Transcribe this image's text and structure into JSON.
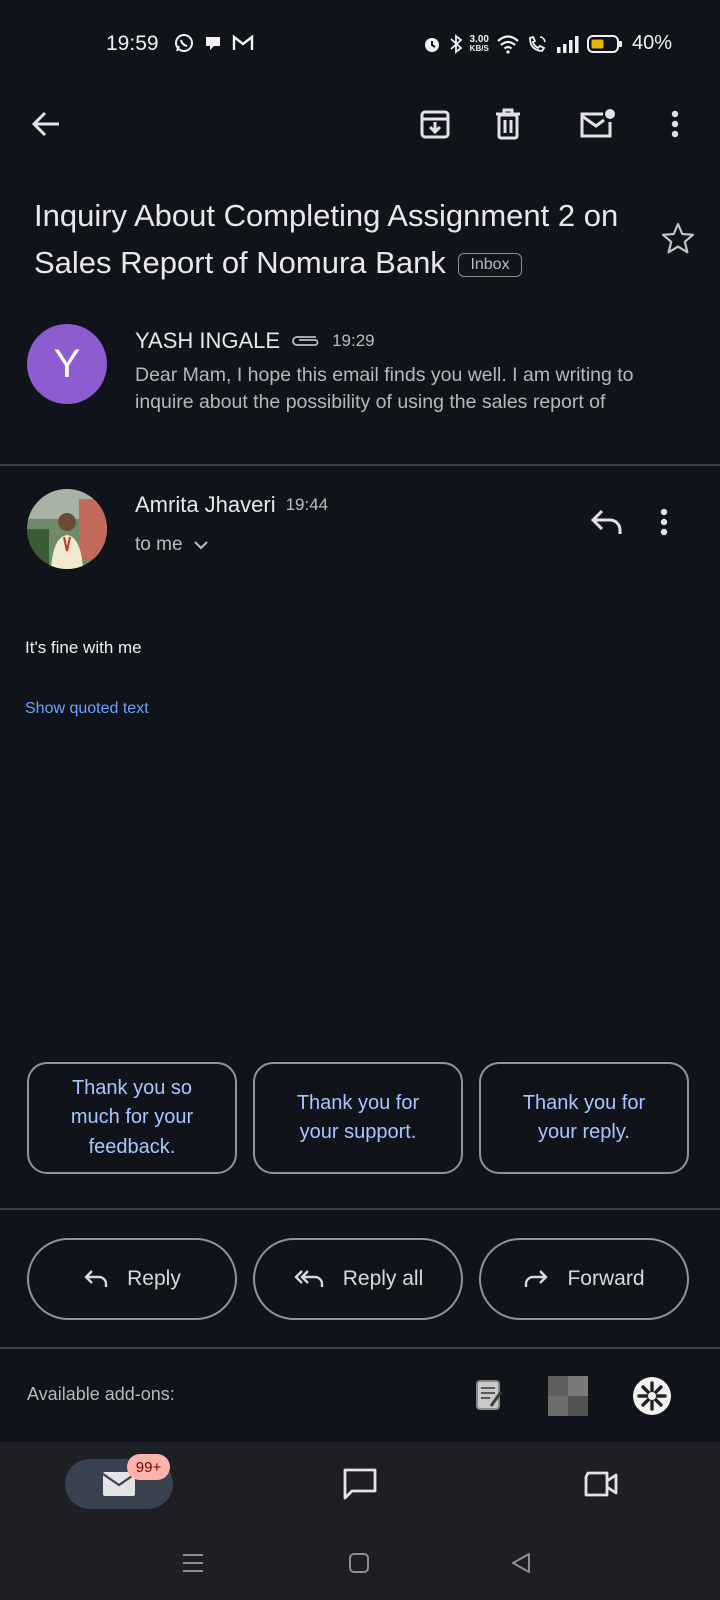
{
  "status_bar": {
    "time": "19:59",
    "net_speed_value": "3.00",
    "net_speed_unit": "KB/S",
    "battery": "40%"
  },
  "topbar": {
    "icons": [
      "back-arrow-icon",
      "archive-icon",
      "delete-icon",
      "mark-unread-icon",
      "more-vert-icon"
    ]
  },
  "thread": {
    "subject": "Inquiry About Completing Assignment 2 on Sales Report of Nomura Bank",
    "label": "Inbox"
  },
  "message1": {
    "avatar_letter": "Y",
    "avatar_color": "#8f5bd1",
    "sender": "YASH INGALE",
    "time": "19:29",
    "snippet": "Dear Mam, I hope this email finds you well. I am writing to inquire about the possibility of using the sales report of"
  },
  "message2": {
    "sender": "Amrita Jhaveri",
    "time": "19:44",
    "recipient": "to me",
    "body": "It's fine with me",
    "show_quoted": "Show quoted text"
  },
  "smart_replies": [
    "Thank you so much for your feedback.",
    "Thank you for your support.",
    "Thank you for your reply."
  ],
  "actions": {
    "reply": "Reply",
    "reply_all": "Reply all",
    "forward": "Forward"
  },
  "addons": {
    "label": "Available add-ons:"
  },
  "bottom_nav": {
    "mail_badge": "99+"
  },
  "colors": {
    "background": "#11131a",
    "accent_link": "#6da3ff",
    "smart_reply_text": "#a9c7ff"
  }
}
